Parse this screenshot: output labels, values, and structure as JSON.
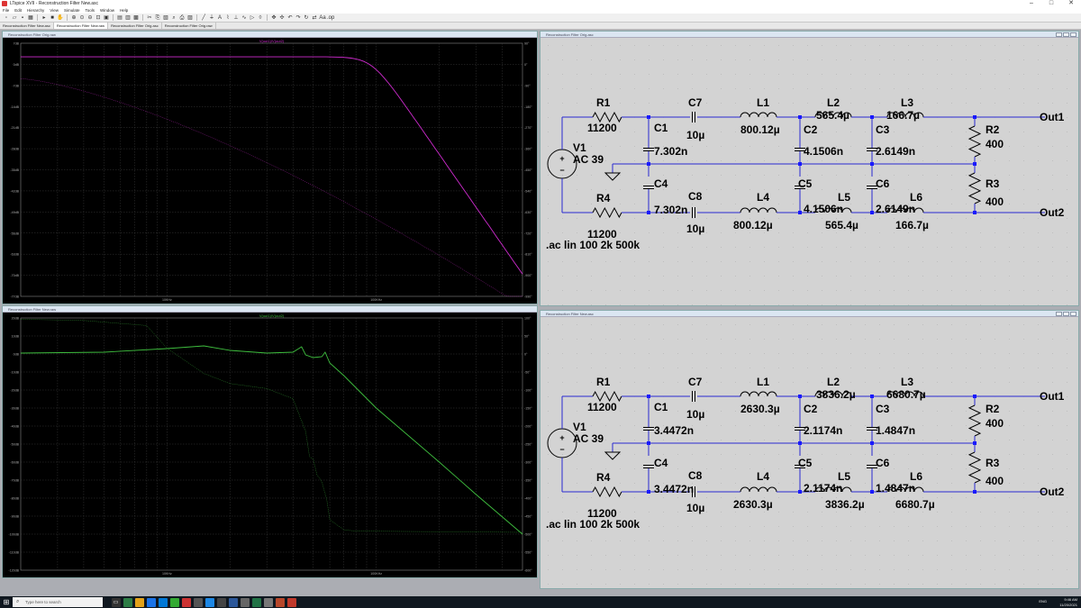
{
  "window": {
    "title": "LTspice XVII - Reconstruction Filter New.asc",
    "minimize": "–",
    "maximize": "□",
    "close": "✕"
  },
  "menu": [
    "File",
    "Edit",
    "Hierarchy",
    "View",
    "Simulate",
    "Tools",
    "Window",
    "Help"
  ],
  "toolbar_icons": [
    "new-icon",
    "open-icon",
    "save-icon",
    "control-panel-icon",
    "run-icon",
    "halt-icon",
    "hand-icon",
    "zoom-in-icon",
    "zoom-pan-icon",
    "zoom-out-icon",
    "zoom-fit-icon",
    "autoscale-icon",
    "tile-horizontal-icon",
    "tile-vertical-icon",
    "close-all-icon",
    "cut-icon",
    "copy-icon",
    "paste-icon",
    "find-icon",
    "print-icon",
    "print-preview-icon",
    "wire-icon",
    "ground-icon",
    "label-icon",
    "resistor-icon",
    "capacitor-icon",
    "inductor-icon",
    "diode-icon",
    "component-icon",
    "move-icon",
    "drag-icon",
    "undo-icon",
    "redo-icon",
    "rotate-icon",
    "mirror-icon",
    "text-icon",
    "spice-directive-icon"
  ],
  "tabs": [
    {
      "label": "Reconstruction Filter New.asc",
      "active": false
    },
    {
      "label": "Reconstruction Filter New.raw",
      "active": true
    },
    {
      "label": "Reconstruction Filter Orig.asc",
      "active": false
    },
    {
      "label": "Reconstruction Filter Orig.raw",
      "active": false
    }
  ],
  "plot1": {
    "window_title": "Reconstruction Filter Orig.raw",
    "trace_label": "V(out1)/V(out2)",
    "trace_color": "#d02bd0",
    "left_ticks": [
      "7dB",
      "0dB",
      "-7dB",
      "-14dB",
      "-21dB",
      "-28dB",
      "-35dB",
      "-42dB",
      "-49dB",
      "-56dB",
      "-63dB",
      "-70dB",
      "-77dB"
    ],
    "right_ticks": [
      "90°",
      "0°",
      "-90°",
      "-180°",
      "-270°",
      "-360°",
      "-450°",
      "-540°",
      "-630°",
      "-720°",
      "-810°",
      "-900°",
      "-990°"
    ],
    "x_ticks": [
      "10KHz",
      "100KHz"
    ]
  },
  "plot2": {
    "window_title": "Reconstruction Filter New.raw",
    "trace_label": "V(out1)/V(out2)",
    "trace_color": "#3fbf3f",
    "left_ticks": [
      "20dB",
      "10dB",
      "0dB",
      "-10dB",
      "-20dB",
      "-30dB",
      "-40dB",
      "-50dB",
      "-60dB",
      "-70dB",
      "-80dB",
      "-90dB",
      "-100dB",
      "-110dB",
      "-120dB"
    ],
    "right_ticks": [
      "100°",
      "50°",
      "0°",
      "-50°",
      "-100°",
      "-150°",
      "-200°",
      "-250°",
      "-300°",
      "-350°",
      "-400°",
      "-450°",
      "-500°",
      "-550°",
      "-600°"
    ],
    "x_ticks": [
      "10KHz",
      "100KHz"
    ]
  },
  "schem1": {
    "window_title": "Reconstruction Filter Orig.asc",
    "labels": {
      "R1": "R1",
      "R1v": "11200",
      "R4": "R4",
      "R4v": "11200",
      "V1": "V1",
      "V1v": "AC 39",
      "C7": "C7",
      "C7v": "10µ",
      "C8": "C8",
      "C8v": "10µ",
      "C1": "C1",
      "C1v": "7.302n",
      "C4": "C4",
      "C4v": "7.302n",
      "L1": "L1",
      "L1v": "800.12µ",
      "L4": "L4",
      "L4v": "800.12µ",
      "C2": "C2",
      "L2": "L2",
      "L2v": "565.4µ",
      "C2v": "4.1506n",
      "C5": "C5",
      "C5v": "4.1506n",
      "L5": "L5",
      "L5v": "565.4µ",
      "C3": "C3",
      "L3": "L3",
      "L3v": "166.7µ",
      "C3v": "2.6149n",
      "C6": "C6",
      "C6v": "2.6149n",
      "L6": "L6",
      "L6v": "166.7µ",
      "R2": "R2",
      "R2v": "400",
      "R3": "R3",
      "R3v": "400",
      "out1": "Out1",
      "out2": "Out2",
      "directive": ".ac lin 100 2k 500k"
    }
  },
  "schem2": {
    "window_title": "Reconstruction Filter New.asc",
    "labels": {
      "R1": "R1",
      "R1v": "11200",
      "R4": "R4",
      "R4v": "11200",
      "V1": "V1",
      "V1v": "AC 39",
      "C7": "C7",
      "C7v": "10µ",
      "C8": "C8",
      "C8v": "10µ",
      "C1": "C1",
      "C1v": "3.4472n",
      "C4": "C4",
      "C4v": "3.4472n",
      "L1": "L1",
      "L1v": "2630.3µ",
      "L4": "L4",
      "L4v": "2630.3µ",
      "C2": "C2",
      "L2": "L2",
      "L2v": "3836.2µ",
      "C2v": "2.1174n",
      "C5": "C5",
      "C5v": "2.1174n",
      "L5": "L5",
      "L5v": "3836.2µ",
      "C3": "C3",
      "L3": "L3",
      "L3v": "6680.7µ",
      "C3v": "1.4847n",
      "C6": "C6",
      "C6v": "1.4847n",
      "L6": "L6",
      "L6v": "6680.7µ",
      "R2": "R2",
      "R2v": "400",
      "R3": "R3",
      "R3v": "400",
      "out1": "Out1",
      "out2": "Out2",
      "directive": ".ac lin 100 2k 500k"
    }
  },
  "taskbar": {
    "search_placeholder": "Type here to search",
    "time": "9:46 AM",
    "date": "11/20/2021",
    "lang": "ENG"
  },
  "colors": {
    "wire": "#2a2ad0",
    "junction": "#1a1aff",
    "schem_bg": "#d3d3d3",
    "plot_grid": "#3a3a3a"
  }
}
